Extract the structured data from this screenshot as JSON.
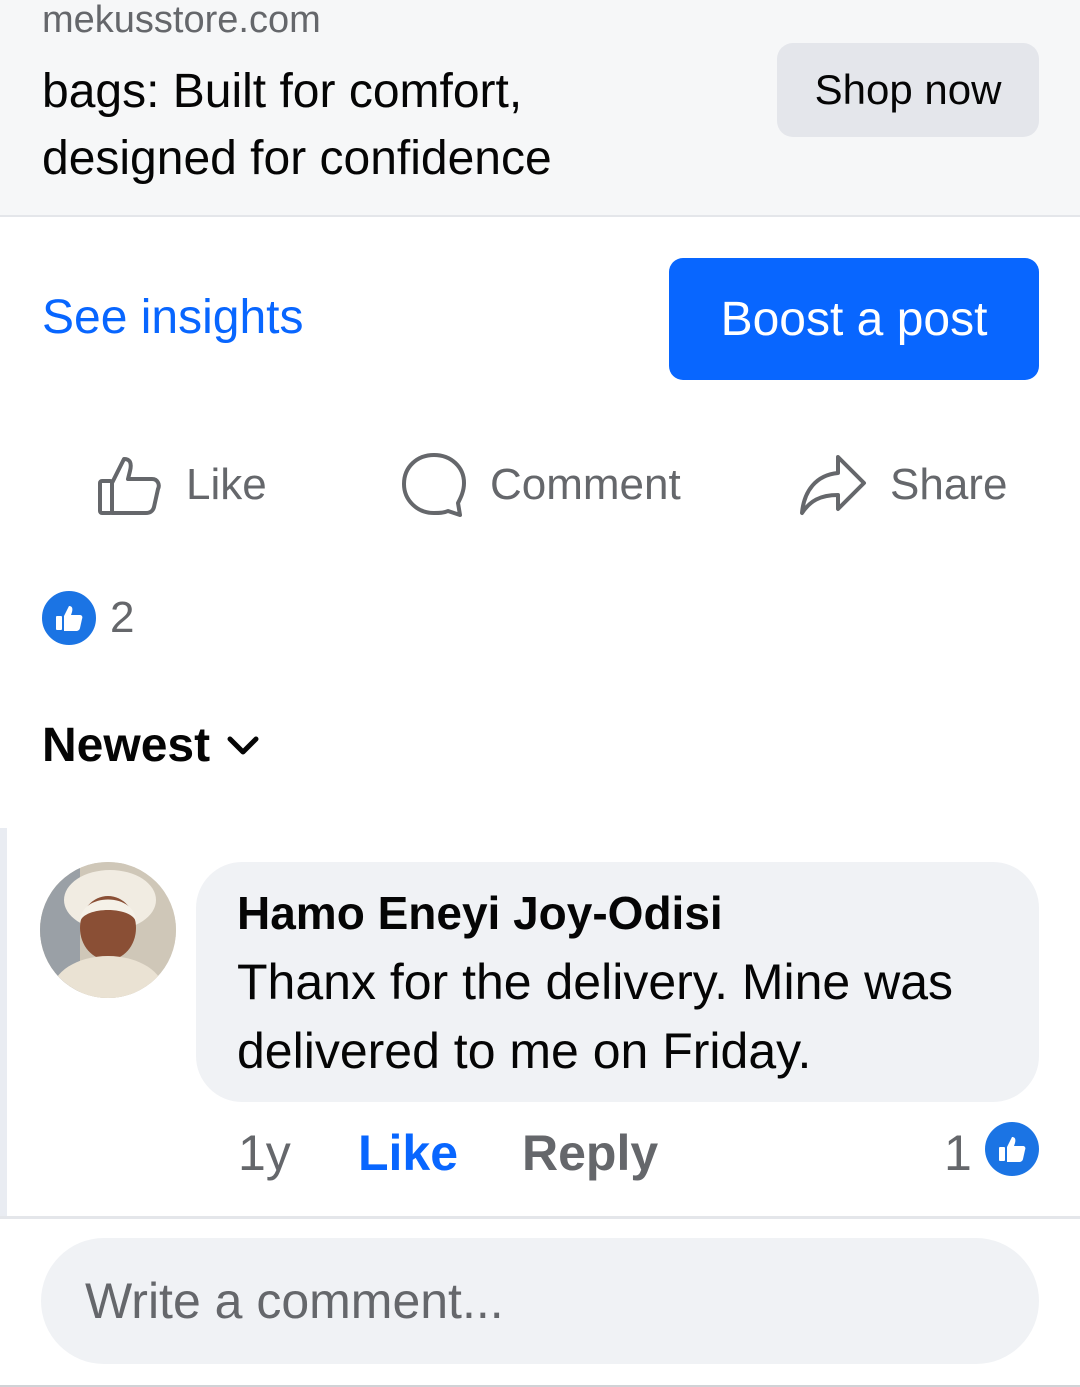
{
  "link_preview": {
    "domain": "mekusstore.com",
    "headline": "bags: Built for comfort, designed for confidence",
    "cta_label": "Shop now"
  },
  "post_tools": {
    "insights_label": "See insights",
    "boost_label": "Boost a post"
  },
  "actions": {
    "like_label": "Like",
    "comment_label": "Comment",
    "share_label": "Share"
  },
  "reactions": {
    "count": "2",
    "icon": "thumbs-up-icon"
  },
  "comments_sort": {
    "label": "Newest",
    "icon": "chevron-down-icon"
  },
  "comments": [
    {
      "author": "Hamo Eneyi Joy-Odisi",
      "text": "Thanx for the delivery. Mine was delivered to me on Friday.",
      "time": "1y",
      "like_label": "Like",
      "reply_label": "Reply",
      "reaction_count": "1"
    }
  ],
  "composer": {
    "placeholder": "Write a comment..."
  },
  "colors": {
    "accent": "#0866ff",
    "reaction_blue": "#1b74e4",
    "secondary_text": "#65676b",
    "bubble_bg": "#f0f2f5"
  }
}
